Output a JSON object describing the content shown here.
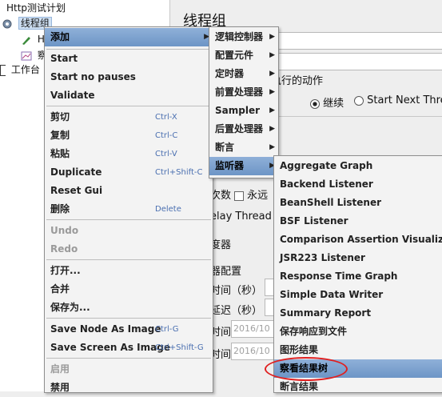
{
  "tree": {
    "root": "Http测试计划",
    "thread_group": "线程组",
    "child1": "H",
    "child2": "察",
    "workbench": "工作台"
  },
  "panel": {
    "title": "线程组",
    "action_label": "执行的动作",
    "continue_label": "继续",
    "start_next_label": "Start Next Threa",
    "loops_label": "次数",
    "forever_label": "永远",
    "delay_label": "elay Thread cr",
    "scheduler_label": "度器",
    "scheduler_config": "器配置",
    "time_label": "时间（秒）",
    "delay_seconds": "延迟（秒）",
    "start_label": "时间",
    "end_label": "时间",
    "start_value": "2016/10",
    "end_value": "2016/10"
  },
  "context_menu": {
    "items": [
      {
        "label": "添加"
      },
      {
        "label": "Start"
      },
      {
        "label": "Start no pauses"
      },
      {
        "label": "Validate"
      },
      {
        "label": "剪切",
        "shortcut": "Ctrl-X"
      },
      {
        "label": "复制",
        "shortcut": "Ctrl-C"
      },
      {
        "label": "粘贴",
        "shortcut": "Ctrl-V"
      },
      {
        "label": "Duplicate",
        "shortcut": "Ctrl+Shift-C"
      },
      {
        "label": "Reset Gui"
      },
      {
        "label": "删除",
        "shortcut": "Delete"
      },
      {
        "label": "Undo"
      },
      {
        "label": "Redo"
      },
      {
        "label": "打开..."
      },
      {
        "label": "合并"
      },
      {
        "label": "保存为..."
      },
      {
        "label": "Save Node As Image",
        "shortcut": "Ctrl-G"
      },
      {
        "label": "Save Screen As Image",
        "shortcut": "Ctrl+Shift-G"
      },
      {
        "label": "启用"
      },
      {
        "label": "禁用"
      }
    ]
  },
  "add_menu": {
    "items": [
      {
        "label": "逻辑控制器"
      },
      {
        "label": "配置元件"
      },
      {
        "label": "定时器"
      },
      {
        "label": "前置处理器"
      },
      {
        "label": "Sampler"
      },
      {
        "label": "后置处理器"
      },
      {
        "label": "断言"
      },
      {
        "label": "监听器"
      }
    ]
  },
  "listener_menu": {
    "items": [
      {
        "label": "Aggregate Graph"
      },
      {
        "label": "Backend Listener"
      },
      {
        "label": "BeanShell Listener"
      },
      {
        "label": "BSF Listener"
      },
      {
        "label": "Comparison Assertion Visualizer"
      },
      {
        "label": "JSR223 Listener"
      },
      {
        "label": "Response Time Graph"
      },
      {
        "label": "Simple Data Writer"
      },
      {
        "label": "Summary Report"
      },
      {
        "label": "保存响应到文件"
      },
      {
        "label": "图形结果"
      },
      {
        "label": "察看结果树"
      },
      {
        "label": "断言结果"
      }
    ]
  },
  "colors": {
    "highlight": "#7aa0cf",
    "annotation": "#e02020",
    "shortcut": "#4a6fb0"
  }
}
